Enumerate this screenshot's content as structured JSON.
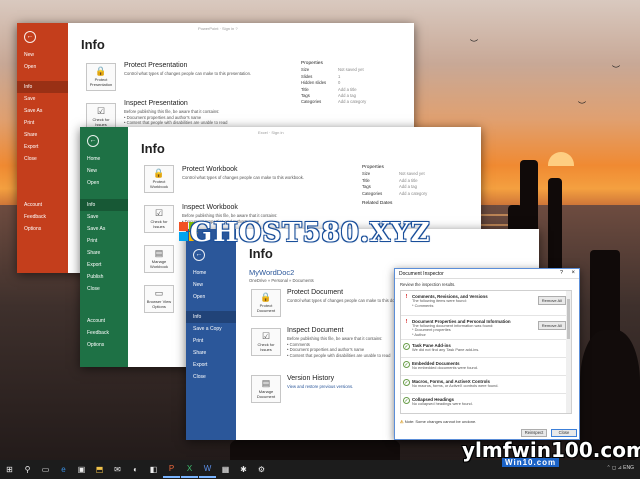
{
  "watermark": {
    "main": "GHOST580.XYZ",
    "corner": "ylmfwin100.com",
    "corner_sub": "Win10.com"
  },
  "ppt": {
    "nav": [
      "New",
      "Open",
      "Info",
      "Save",
      "Save As",
      "Print",
      "Share",
      "Export",
      "Close",
      "Account",
      "Feedback",
      "Options"
    ],
    "top": "PowerPoint   ·   Sign in   ?",
    "heading": "Info",
    "protect_title": "Protect Presentation",
    "protect_desc": "Control what types of changes people can make to this presentation.",
    "protect_tile": "Protect Presentation",
    "inspect_title": "Inspect Presentation",
    "inspect_desc": [
      "Before publishing this file, be aware that it contains:",
      "Document properties and author's name",
      "Content that people with disabilities are unable to read"
    ],
    "inspect_tile": "Check for Issues",
    "properties": {
      "header": "Properties",
      "rows": [
        [
          "Size",
          "Not saved yet"
        ],
        [
          "Slides",
          "1"
        ],
        [
          "Hidden slides",
          "0"
        ],
        [
          "Title",
          "Add a title"
        ],
        [
          "Tags",
          "Add a tag"
        ],
        [
          "Categories",
          "Add a category"
        ]
      ]
    }
  },
  "excel": {
    "nav": [
      "Home",
      "New",
      "Open",
      "Info",
      "Save",
      "Save As",
      "Print",
      "Share",
      "Export",
      "Publish",
      "Close",
      "Account",
      "Feedback",
      "Options"
    ],
    "top": "Excel   ·   Sign in",
    "heading": "Info",
    "protect_title": "Protect Workbook",
    "protect_desc": "Control what types of changes people can make to this workbook.",
    "protect_tile": "Protect Workbook",
    "inspect_title": "Inspect Workbook",
    "inspect_desc": [
      "Before publishing this file, be aware that it contains:",
      "Document properties and author's name"
    ],
    "inspect_tile": "Check for Issues",
    "manage_tile": "Manage Workbook",
    "browser_tile": "Browser View Options",
    "properties": {
      "header": "Properties",
      "rows": [
        [
          "Size",
          "Not saved yet"
        ],
        [
          "Title",
          "Add a title"
        ],
        [
          "Tags",
          "Add a tag"
        ],
        [
          "Categories",
          "Add a category"
        ]
      ]
    },
    "related": "Related Dates"
  },
  "word": {
    "nav": [
      "Home",
      "New",
      "Open",
      "Info",
      "Save a Copy",
      "Print",
      "Share",
      "Export",
      "Close"
    ],
    "heading": "Info",
    "doc_name": "MyWordDoc2",
    "path": "OneDrive » Personal » Documents",
    "protect_title": "Protect Document",
    "protect_desc": "Control what types of changes people can make to this document.",
    "protect_tile": "Protect Document",
    "inspect_title": "Inspect Document",
    "inspect_desc": [
      "Before publishing this file, be aware that it contains:",
      "Comments",
      "Document properties and author's name",
      "Content that people with disabilities are unable to read"
    ],
    "inspect_tile": "Check for Issues",
    "version_title": "Version History",
    "version_desc": "View and restore previous versions.",
    "version_tile": "Manage Document"
  },
  "dialog": {
    "title": "Document Inspector",
    "intro": "Review the inspection results.",
    "items": [
      {
        "status": "warn",
        "title": "Comments, Revisions, and Versions",
        "desc": "The following items were found:\n* Comments",
        "button": "Remove All"
      },
      {
        "status": "warn",
        "title": "Document Properties and Personal Information",
        "desc": "The following document information was found:\n* Document properties\n* Author",
        "button": "Remove All"
      },
      {
        "status": "ok",
        "title": "Task Pane Add-ins",
        "desc": "We did not find any Task Pane add-ins.",
        "button": ""
      },
      {
        "status": "ok",
        "title": "Embedded Documents",
        "desc": "No embedded documents were found.",
        "button": ""
      },
      {
        "status": "ok",
        "title": "Macros, Forms, and ActiveX Controls",
        "desc": "No macros, forms, or ActiveX controls were found.",
        "button": ""
      },
      {
        "status": "ok",
        "title": "Collapsed Headings",
        "desc": "No collapsed headings were found.",
        "button": ""
      }
    ],
    "note": "Note: Some changes cannot be undone.",
    "reinspect": "Reinspect",
    "close": "Close"
  },
  "taskbar": {
    "icons": [
      "⊞",
      "⚲",
      "▭",
      "e",
      "▣",
      "⬒",
      "✉",
      "◐",
      "◧",
      "P",
      "X",
      "W",
      "▦",
      "✱",
      "⚙"
    ],
    "tray": "⌃ ◻ ⊿ ENG"
  }
}
